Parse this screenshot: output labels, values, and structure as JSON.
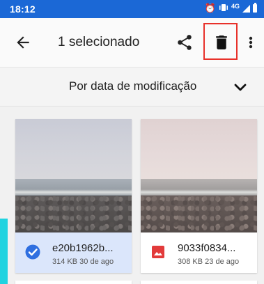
{
  "status_bar": {
    "time": "18:12",
    "network": "4G"
  },
  "app_bar": {
    "title": "1 selecionado",
    "actions": [
      "back-arrow-icon",
      "share-icon",
      "delete-icon",
      "more-vert-icon"
    ],
    "highlight_color": "#e8312a"
  },
  "sort": {
    "label": "Por data de modificação"
  },
  "files": [
    {
      "name": "e20b1962b...",
      "size": "314 KB",
      "date": "30 de ago",
      "selected": true,
      "icon": "check-circle-icon"
    },
    {
      "name": "9033f0834...",
      "size": "308 KB",
      "date": "23 de ago",
      "selected": false,
      "icon": "image-file-icon"
    }
  ],
  "colors": {
    "status_bar": "#1b68d6",
    "selected_card": "#dbe6fb",
    "check_icon": "#2f6fe0",
    "image_icon": "#e23b3b",
    "edge_accent": "#1fd3e0"
  }
}
